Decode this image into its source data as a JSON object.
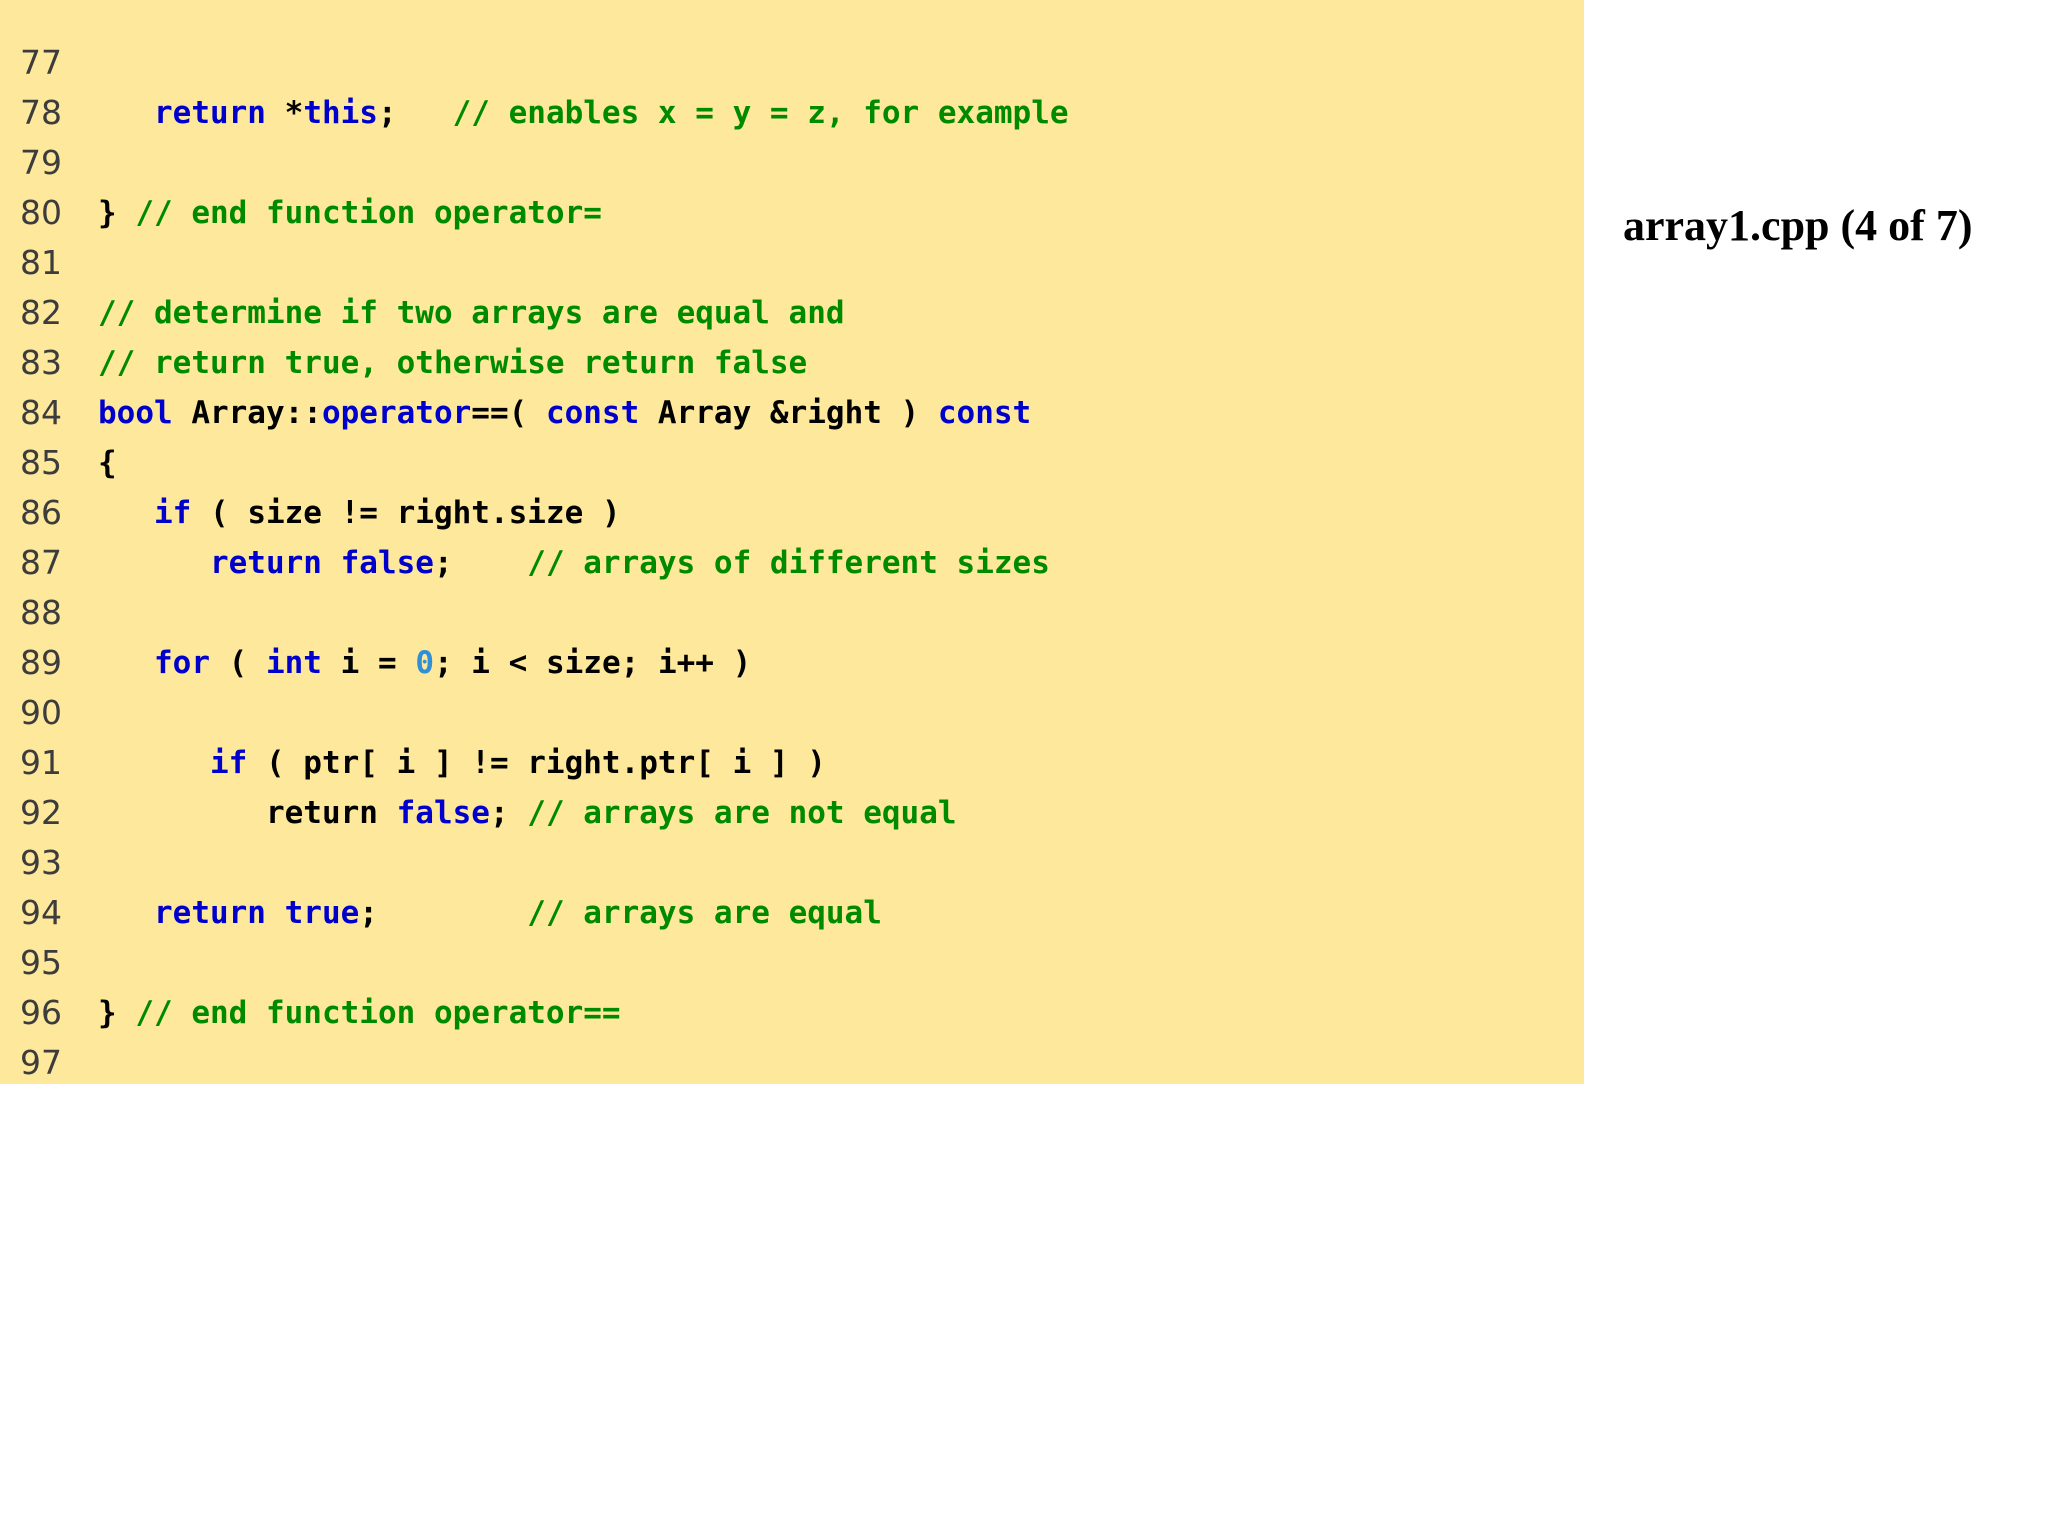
{
  "slide": {
    "title": "array1.cpp (4 of 7)"
  },
  "colors": {
    "panel_background": "#fde89c",
    "keyword": "#0000cc",
    "comment": "#008a00",
    "number": "#2f8fd8",
    "plain": "#000000",
    "line_number": "#3c3c3c"
  },
  "code": {
    "lines": [
      {
        "number": "77",
        "tokens": []
      },
      {
        "number": "78",
        "tokens": [
          {
            "t": "kw",
            "v": "   return"
          },
          {
            "t": "pl",
            "v": " *"
          },
          {
            "t": "kw",
            "v": "this"
          },
          {
            "t": "pl",
            "v": ";   "
          },
          {
            "t": "cm",
            "v": "// enables x = y = z, for example"
          }
        ]
      },
      {
        "number": "79",
        "tokens": []
      },
      {
        "number": "80",
        "tokens": [
          {
            "t": "pl",
            "v": "} "
          },
          {
            "t": "cm",
            "v": "// end function operator="
          }
        ]
      },
      {
        "number": "81",
        "tokens": []
      },
      {
        "number": "82",
        "tokens": [
          {
            "t": "cm",
            "v": "// determine if two arrays are equal and"
          }
        ]
      },
      {
        "number": "83",
        "tokens": [
          {
            "t": "cm",
            "v": "// return true, otherwise return false"
          }
        ]
      },
      {
        "number": "84",
        "tokens": [
          {
            "t": "kw",
            "v": "bool"
          },
          {
            "t": "pl",
            "v": " Array::"
          },
          {
            "t": "kw",
            "v": "operator"
          },
          {
            "t": "pl",
            "v": "==( "
          },
          {
            "t": "kw",
            "v": "const"
          },
          {
            "t": "pl",
            "v": " Array &right ) "
          },
          {
            "t": "kw",
            "v": "const"
          }
        ]
      },
      {
        "number": "85",
        "tokens": [
          {
            "t": "pl",
            "v": "{"
          }
        ]
      },
      {
        "number": "86",
        "tokens": [
          {
            "t": "kw",
            "v": "   if"
          },
          {
            "t": "pl",
            "v": " ( size != right.size )"
          }
        ]
      },
      {
        "number": "87",
        "tokens": [
          {
            "t": "kw",
            "v": "      return false"
          },
          {
            "t": "pl",
            "v": ";    "
          },
          {
            "t": "cm",
            "v": "// arrays of different sizes"
          }
        ]
      },
      {
        "number": "88",
        "tokens": []
      },
      {
        "number": "89",
        "tokens": [
          {
            "t": "kw",
            "v": "   for"
          },
          {
            "t": "pl",
            "v": " ( "
          },
          {
            "t": "kw",
            "v": "int"
          },
          {
            "t": "pl",
            "v": " i = "
          },
          {
            "t": "nm",
            "v": "0"
          },
          {
            "t": "pl",
            "v": "; i < size; i++ )"
          }
        ]
      },
      {
        "number": "90",
        "tokens": []
      },
      {
        "number": "91",
        "tokens": [
          {
            "t": "kw",
            "v": "      if"
          },
          {
            "t": "pl",
            "v": " ( ptr[ i ] != right.ptr[ i ] )"
          }
        ]
      },
      {
        "number": "92",
        "tokens": [
          {
            "t": "pl",
            "v": "         return "
          },
          {
            "t": "kw",
            "v": "false"
          },
          {
            "t": "pl",
            "v": "; "
          },
          {
            "t": "cm",
            "v": "// arrays are not equal"
          }
        ]
      },
      {
        "number": "93",
        "tokens": []
      },
      {
        "number": "94",
        "tokens": [
          {
            "t": "kw",
            "v": "   return true"
          },
          {
            "t": "pl",
            "v": ";        "
          },
          {
            "t": "cm",
            "v": "// arrays are equal"
          }
        ]
      },
      {
        "number": "95",
        "tokens": []
      },
      {
        "number": "96",
        "tokens": [
          {
            "t": "pl",
            "v": "} "
          },
          {
            "t": "cm",
            "v": "// end function operator=="
          }
        ]
      },
      {
        "number": "97",
        "tokens": []
      }
    ]
  }
}
